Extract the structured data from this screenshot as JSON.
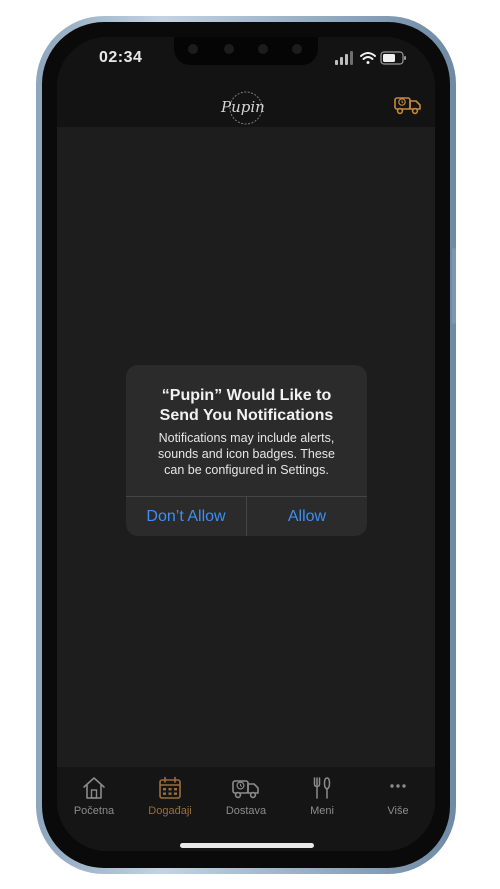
{
  "status_bar": {
    "time": "02:34"
  },
  "app_bar": {
    "logo_text": "Pupin"
  },
  "alert": {
    "title_line1": "“Pupin” Would Like to",
    "title_line2": "Send You Notifications",
    "message_line1": "Notifications may include alerts,",
    "message_line2": "sounds and icon badges. These",
    "message_line3": "can be configured in Settings.",
    "deny_label": "Don’t Allow",
    "allow_label": "Allow"
  },
  "tabs": [
    {
      "label": "Početna",
      "icon": "home-icon",
      "active": false
    },
    {
      "label": "Događaji",
      "icon": "calendar-icon",
      "active": true
    },
    {
      "label": "Dostava",
      "icon": "delivery-truck-icon",
      "active": false
    },
    {
      "label": "Meni",
      "icon": "fork-knife-icon",
      "active": false
    },
    {
      "label": "Više",
      "icon": "more-icon",
      "active": false
    }
  ],
  "colors": {
    "accent": "#9a6d3e",
    "alert_button": "#3d8ff0",
    "tab_inactive": "#8b8b8b"
  }
}
